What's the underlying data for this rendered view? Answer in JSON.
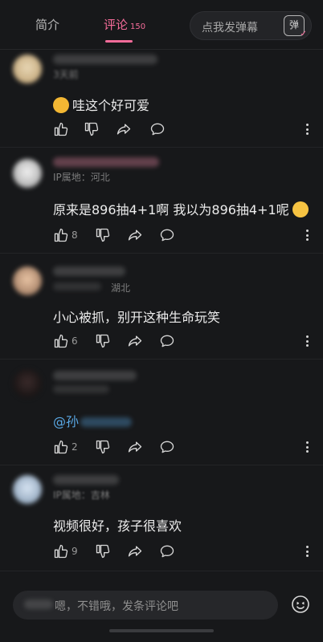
{
  "tabs": {
    "intro_label": "简介",
    "comments_label": "评论",
    "comments_count": "150",
    "danmu_placeholder": "点我发弹幕",
    "danmu_icon_label": "弹"
  },
  "comments": [
    {
      "meta": "3天前",
      "text": "哇这个好可爱",
      "likes": ""
    },
    {
      "meta": "IP属地：河北",
      "text": "原来是896抽4+1啊 我以为896抽4+1呢",
      "likes": "8"
    },
    {
      "meta": "湖北",
      "text": "小心被抓，别开这种生命玩笑",
      "likes": "6"
    },
    {
      "meta": "",
      "text": "@孙",
      "likes": "2"
    },
    {
      "meta": "IP属地：吉林",
      "text": "视频很好，孩子很喜欢",
      "likes": "9"
    }
  ],
  "input": {
    "placeholder": "嗯，不错哦，发条评论吧"
  },
  "colors": {
    "accent": "#f56c9a",
    "background": "#17181a",
    "mention": "#5aa9e6"
  },
  "icons": [
    "like-icon",
    "dislike-icon",
    "share-icon",
    "reply-icon",
    "more-icon",
    "emoji-icon",
    "danmu-icon"
  ]
}
